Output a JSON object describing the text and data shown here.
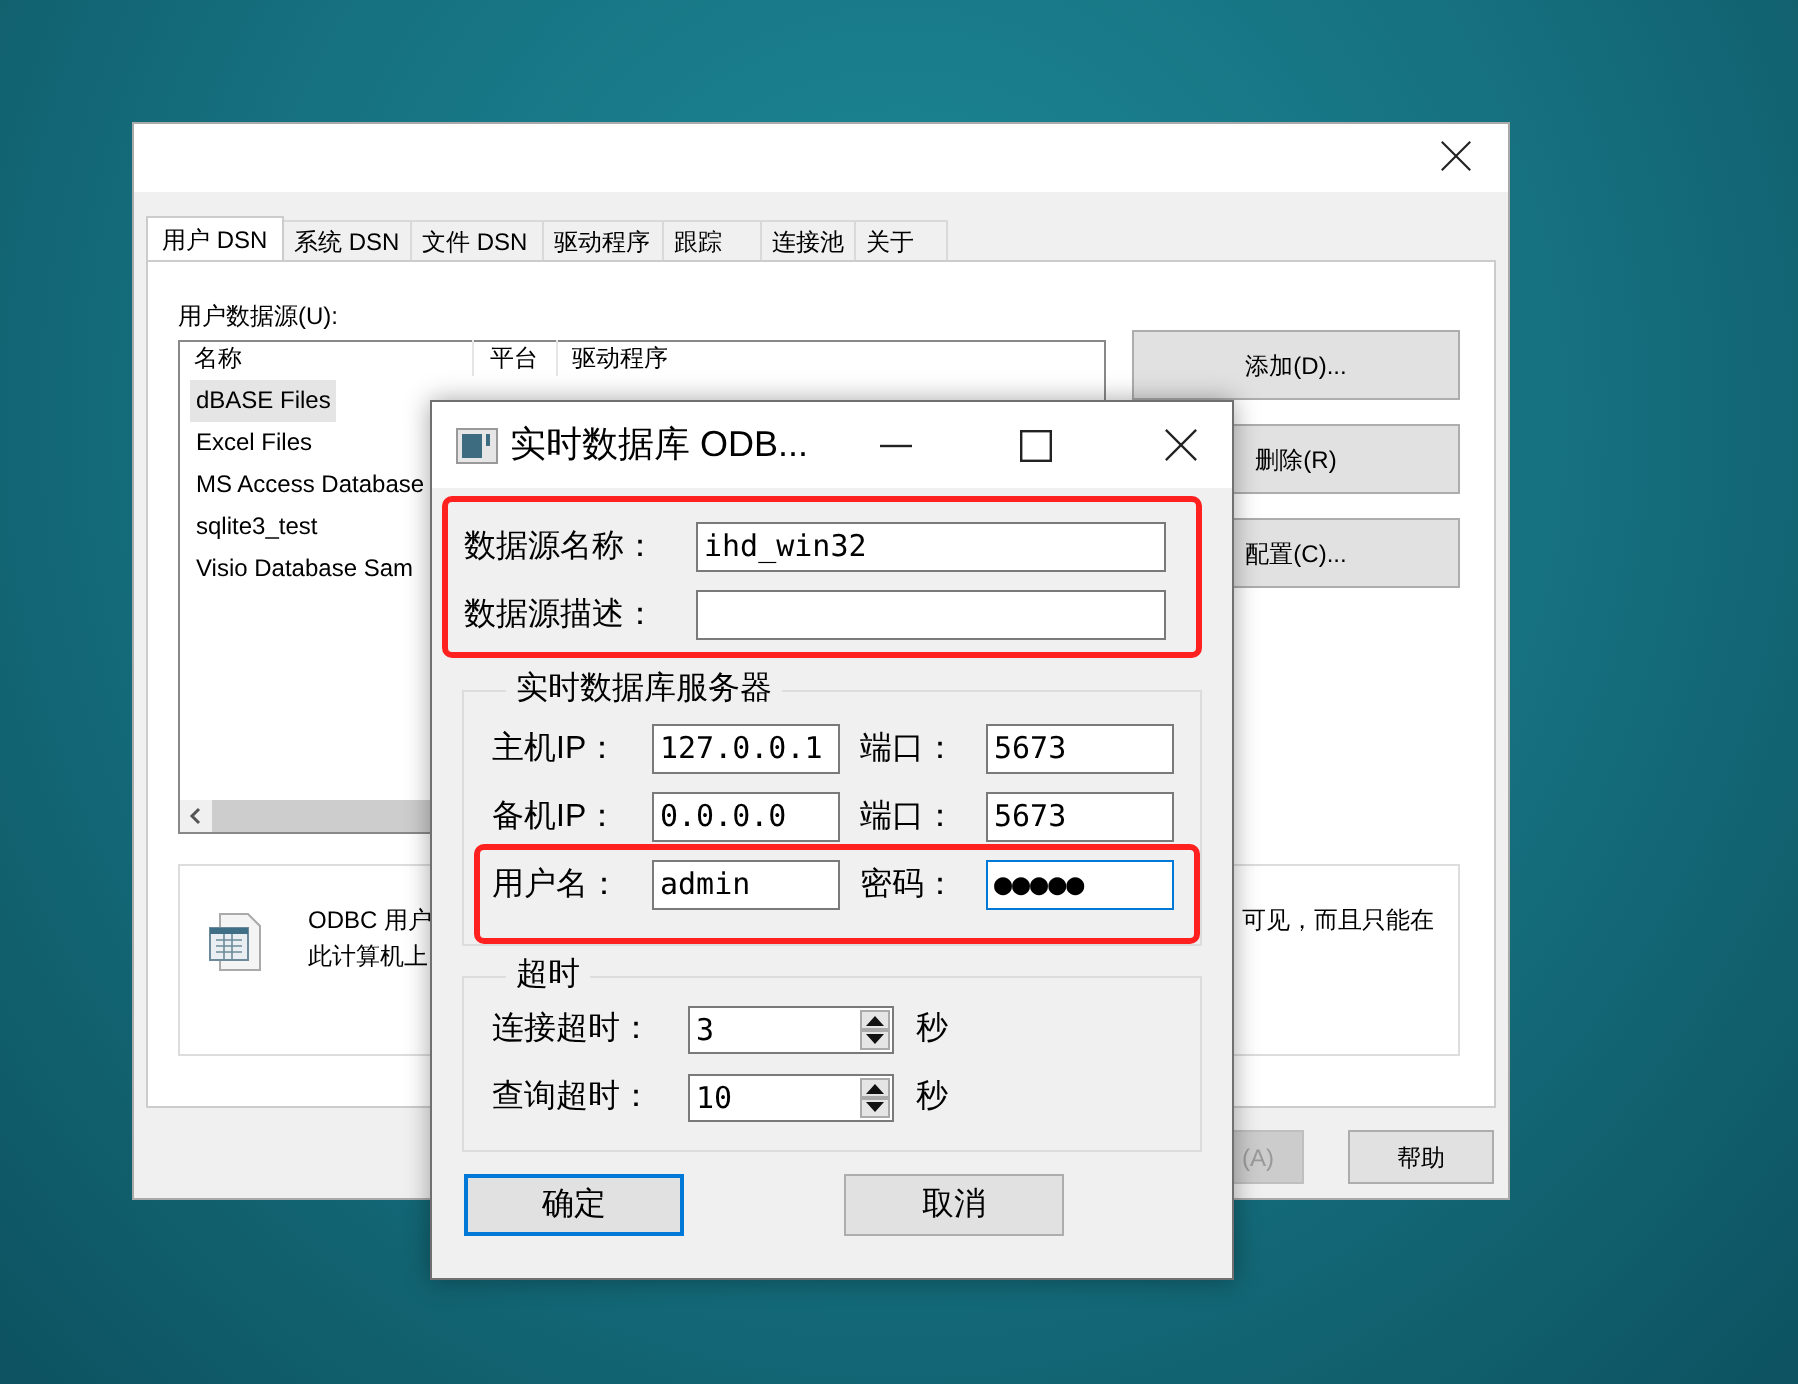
{
  "odbc_window": {
    "tabs": [
      {
        "label": "用户 DSN",
        "selected": true
      },
      {
        "label": "系统 DSN",
        "selected": false
      },
      {
        "label": "文件 DSN",
        "selected": false
      },
      {
        "label": "驱动程序",
        "selected": false
      },
      {
        "label": "跟踪",
        "selected": false
      },
      {
        "label": "连接池",
        "selected": false
      },
      {
        "label": "关于",
        "selected": false
      }
    ],
    "list_label": "用户数据源(U):",
    "columns": [
      "名称",
      "平台",
      "驱动程序"
    ],
    "rows": [
      {
        "name": "dBASE Files",
        "selected": true
      },
      {
        "name": "Excel Files",
        "selected": false
      },
      {
        "name": "MS Access Database",
        "selected": false
      },
      {
        "name": "sqlite3_test",
        "selected": false
      },
      {
        "name": "Visio Database Sam",
        "selected": false
      }
    ],
    "buttons": [
      "添加(D)...",
      "删除(R)",
      "配置(C)..."
    ],
    "info_text_left": [
      "ODBC 用户",
      "此计算机上"
    ],
    "info_text_right": "可见，而且只能在",
    "bottom_buttons": [
      {
        "label": "(A)",
        "disabled": true
      },
      {
        "label": "帮助",
        "disabled": false
      }
    ]
  },
  "dialog": {
    "title": "实时数据库 ODB...",
    "source_fields": [
      {
        "label": "数据源名称：",
        "value": "ihd_win32"
      },
      {
        "label": "数据源描述："
      }
    ],
    "server_group": {
      "title": "实时数据库服务器",
      "rows": [
        {
          "label": "主机IP：",
          "value": "127.0.0.1",
          "port_label": "端口：",
          "port_value": "5673",
          "focused": false
        },
        {
          "label": "备机IP：",
          "value": "0.0.0.0",
          "port_label": "端口：",
          "port_value": "5673",
          "focused": false
        },
        {
          "label": "用户名：",
          "value": "admin",
          "port_label": "密码：",
          "port_value": "●●●●●",
          "focused": true
        }
      ]
    },
    "timeout_group": {
      "title": "超时",
      "rows": [
        {
          "label": "连接超时：",
          "value": "3",
          "unit": "秒"
        },
        {
          "label": "查询超时：",
          "value": "10",
          "unit": "秒"
        }
      ]
    },
    "buttons": [
      {
        "label": "确定",
        "default": true
      },
      {
        "label": "取消",
        "default": false
      }
    ]
  }
}
